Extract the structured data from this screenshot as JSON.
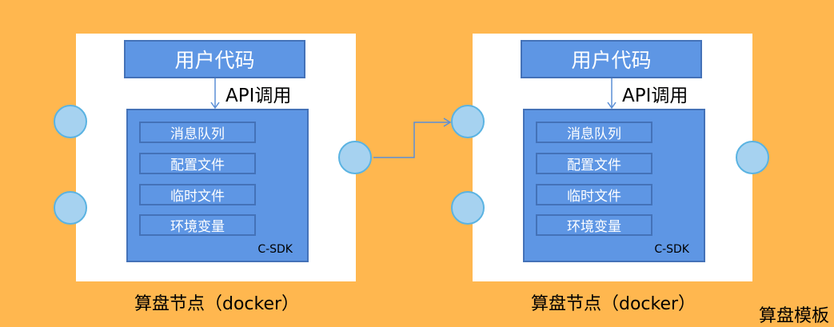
{
  "nodes": [
    {
      "user_code": "用户代码",
      "api_call": "API调用",
      "sdk_items": [
        "消息队列",
        "配置文件",
        "临时文件",
        "环境变量"
      ],
      "sdk_label": "C-SDK",
      "caption": "算盘节点（docker）"
    },
    {
      "user_code": "用户代码",
      "api_call": "API调用",
      "sdk_items": [
        "消息队列",
        "配置文件",
        "临时文件",
        "环境变量"
      ],
      "sdk_label": "C-SDK",
      "caption": "算盘节点（docker）"
    }
  ],
  "template_label": "算盘模板",
  "colors": {
    "background": "#FFB74F",
    "box": "#5E96E4",
    "border": "#4472B8",
    "port": "#A6D2F0",
    "connector": "#5B8FD6"
  }
}
